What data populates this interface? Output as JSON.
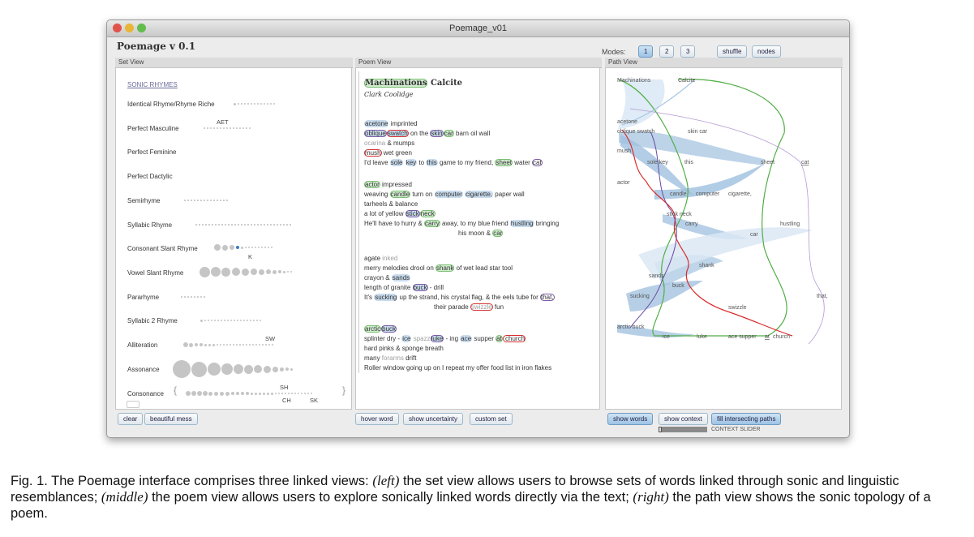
{
  "window": {
    "title": "Poemage_v01"
  },
  "app_title": "Poemage v 0.1",
  "toolbar": {
    "modes_label": "Modes:",
    "mode_buttons": [
      "1",
      "2",
      "3"
    ],
    "shuffle": "shuffle",
    "nodes": "nodes"
  },
  "set_view": {
    "header": "Set View",
    "section": "SONIC RHYMES",
    "rows": [
      "Identical Rhyme/Rhyme Riche",
      "Perfect Masculine",
      "Perfect Feminine",
      "Perfect Dactylic",
      "Semirhyme",
      "Syllabic Rhyme",
      "Consonant Slant Rhyme",
      "Vowel Slant Rhyme",
      "Pararhyme",
      "Syllabic 2 Rhyme",
      "Alliteration",
      "Assonance",
      "Consonance"
    ],
    "tags": {
      "aet": "AET",
      "k": "K",
      "sw": "SW",
      "sh": "SH",
      "ch": "CH",
      "sk": "SK"
    },
    "buttons": {
      "clear": "clear",
      "beautiful_mess": "beautiful mess"
    }
  },
  "poem_view": {
    "header": "Poem View",
    "title_a": "Machinations",
    "title_b": "Calcite",
    "author": "Clark Coolidge",
    "buttons": {
      "hover": "hover word",
      "uncertainty": "show uncertainty",
      "custom": "custom set"
    },
    "s1": {
      "l1a": "acetone",
      "l1b": " imprinted",
      "l2a": "oblique",
      "l2b": "swatch",
      "l2c": " on the ",
      "l2d": "skin",
      "l2e": "car",
      "l2f": " barn oil wall",
      "l3a": "ocarina",
      "l3b": " & mumps",
      "l4a": "mush",
      "l4b": " wet green",
      "l5a": "I'd leave ",
      "l5b": "sole",
      "l5c": "key",
      "l5d": " to ",
      "l5e": "this",
      "l5f": " game to my friend, ",
      "l5g": "sheet",
      "l5h": " water ",
      "l5i": "cat"
    },
    "s2": {
      "l1a": "actor",
      "l1b": " impressed",
      "l2a": "weaving ",
      "l2b": "candle",
      "l2c": " turn on ",
      "l2d": "computer",
      "l2e": " ",
      "l2f": "cigarette,",
      "l2g": " paper wall",
      "l3": "tarheels & balance",
      "l4a": "a lot of yellow ",
      "l4b": "stick",
      "l4c": "neck",
      "l5a": "He'll have to hurry & ",
      "l5b": "carry",
      "l5c": " away, to my blue friend ",
      "l5d": "hustling",
      "l5e": " bringing",
      "l6a": "his moon & ",
      "l6b": "car"
    },
    "s3": {
      "l1a": "agate ",
      "l1b": "inked",
      "l2a": "merry melodies drool on ",
      "l2b": "shank",
      "l2c": " of wet lead star tool",
      "l3a": "crayon & ",
      "l3b": "sands",
      "l4a": "length of granite ",
      "l4b": "buck",
      "l4c": " - drill",
      "l5a": "It's ",
      "l5b": "sucking",
      "l5c": " up the strand, his crystal flag, & the eels tube for ",
      "l5d": "that,",
      "l6a": "their parade ",
      "l6b": "swizzle",
      "l6c": " fun"
    },
    "s4": {
      "l1a": "arctic",
      "l1b": "buck",
      "l2a": "splinter dry - ",
      "l2b": "ice",
      "l2c": " spazz",
      "l2d": "luke",
      "l2e": " - ing ",
      "l2f": "ace",
      "l2g": " supper ",
      "l2h": "at",
      "l2i": " church",
      "l3": "hard pinks & sponge breath",
      "l4a": "many ",
      "l4b": "forarms",
      "l4c": " drift",
      "l5": "Roller window going up on I repeat my offer food list in iron flakes"
    }
  },
  "path_view": {
    "header": "Path View",
    "labels": {
      "machinations": "Machinations",
      "calcite": "Calcite",
      "acetone": "acetone",
      "oblique_swatch": "oblique swatch",
      "skin_car": "skin car",
      "mush": "mush",
      "sole_key": "sole key",
      "this": "this",
      "sheet": "sheet",
      "cat": "cat",
      "actor": "actor",
      "candle": "candle",
      "computer": "computer",
      "cigarette": "cigarette,",
      "stick": "stick neck",
      "carry": "carry",
      "hustling": "hustling",
      "car": "car",
      "shank": "shank",
      "sands": "sands",
      "buck": "buck",
      "sucking": "sucking",
      "that": "that,",
      "swizzle": "swizzle",
      "arctic_buck": "arctic buck",
      "ice": "ice",
      "luke": "luke",
      "ace_supper": "ace supper",
      "at": "at",
      "church": "church"
    },
    "buttons": {
      "show_words": "show words",
      "show_context": "show context",
      "fill_paths": "fill intersecting paths"
    },
    "slider_label": "CONTEXT SLIDER"
  },
  "caption": {
    "a": "Fig. 1. The Poemage interface comprises three linked views: ",
    "left": "(left)",
    "b": " the set view allows users to browse sets of words linked through sonic and linguistic resemblances; ",
    "middle": "(middle)",
    "c": " the poem view allows users to explore sonically linked words directly via the text; ",
    "right": "(right)",
    "d": " the path view shows the sonic topology of a poem."
  }
}
